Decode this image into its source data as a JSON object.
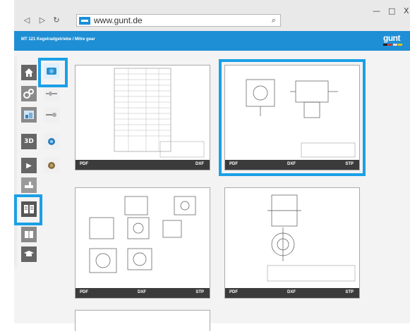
{
  "browser": {
    "back_icon": "◁",
    "forward_icon": "▷",
    "reload_icon": "↻",
    "url": "www.gunt.de",
    "search_icon": "⌕",
    "minimize_icon": "—",
    "maximize_icon": "□",
    "close_icon": "X"
  },
  "header": {
    "title": "MT 121 Kegelradgetriebe / Mitre gear",
    "logo": "gunt"
  },
  "sidebar": {
    "items": [
      {
        "name": "home-icon",
        "glyph": "⌂"
      },
      {
        "name": "model-3d-icon",
        "glyph": ""
      },
      {
        "name": "assembly-icon",
        "glyph": "⚙"
      },
      {
        "name": "image-icon",
        "glyph": ""
      },
      {
        "name": "view-3d-icon",
        "glyph": "3D"
      },
      {
        "name": "play-icon",
        "glyph": "▶"
      },
      {
        "name": "tools-icon",
        "glyph": ""
      },
      {
        "name": "documents-icon",
        "glyph": ""
      },
      {
        "name": "book-icon",
        "glyph": ""
      },
      {
        "name": "education-icon",
        "glyph": ""
      }
    ]
  },
  "documents": [
    {
      "labels": [
        "PDF",
        "DXF"
      ]
    },
    {
      "labels": [
        "PDF",
        "DXF",
        "STP"
      ]
    },
    {
      "labels": [
        "PDF",
        "DXF",
        "STP"
      ]
    },
    {
      "labels": [
        "PDF",
        "DXF",
        "STP"
      ]
    }
  ],
  "colors": {
    "accent": "#1aa0e6",
    "header": "#1e8fd5",
    "card_bar": "#3b3b3b"
  }
}
